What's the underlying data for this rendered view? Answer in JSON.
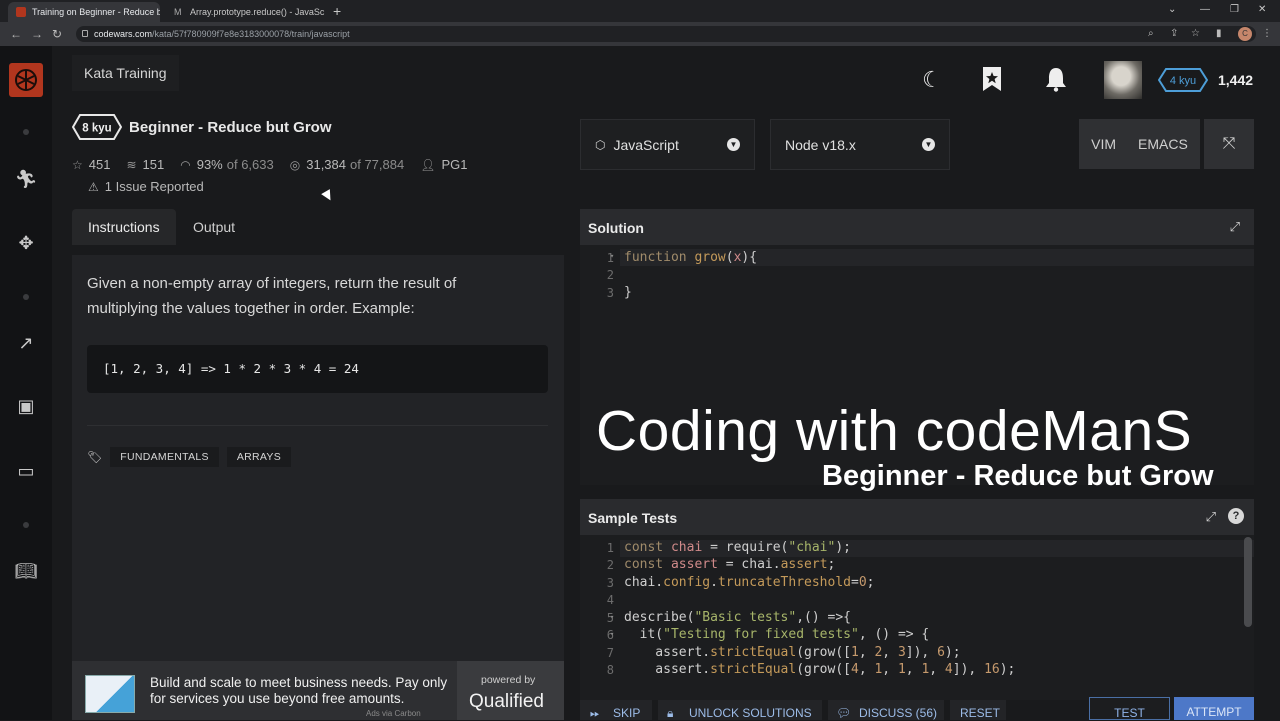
{
  "browser": {
    "tabs": [
      {
        "title": "Training on Beginner - Reduce bu",
        "active": true
      },
      {
        "title": "Array.prototype.reduce() - JavaSc",
        "active": false
      }
    ],
    "url_host": "codewars.com",
    "url_path": "/kata/57f780909f7e8e3183000078/train/javascript",
    "profile_initial": "C"
  },
  "header": {
    "section": "Kata Training",
    "user_rank": "4 kyu",
    "honor": "1,442"
  },
  "kata": {
    "rank": "8 kyu",
    "title": "Beginner - Reduce but Grow",
    "stars": "451",
    "collections": "151",
    "satisfaction_pct": "93%",
    "satisfaction_of": "of 6,633",
    "completed": "31,384",
    "completed_of": "of 77,884",
    "author": "PG1",
    "issues": "1 Issue Reported"
  },
  "tabs": {
    "instructions": "Instructions",
    "output": "Output"
  },
  "description": {
    "text": "Given a non-empty array of integers, return the result of multiplying the values together in order. Example:",
    "example": "[1, 2, 3, 4] => 1 * 2 * 3 * 4 = 24",
    "tags": [
      "FUNDAMENTALS",
      "ARRAYS"
    ]
  },
  "ad": {
    "text": "Build and scale to meet business needs. Pay only for services you use beyond free amounts.",
    "powered_by": "powered by",
    "brand": "Qualified",
    "via": "Ads via Carbon"
  },
  "editor_settings": {
    "language": "JavaScript",
    "runtime": "Node v18.x",
    "vim": "VIM",
    "emacs": "EMACS"
  },
  "solution": {
    "heading": "Solution",
    "line_numbers": [
      "1",
      "2",
      "3"
    ]
  },
  "overlay": {
    "title": "Coding with codeManS",
    "subtitle": "Beginner - Reduce but Grow"
  },
  "sample_tests": {
    "heading": "Sample Tests",
    "line_numbers": [
      "1",
      "2",
      "3",
      "4",
      "5",
      "6",
      "7",
      "8"
    ]
  },
  "actions": {
    "skip": "SKIP",
    "unlock": "UNLOCK SOLUTIONS",
    "discuss": "DISCUSS (56)",
    "reset": "RESET",
    "test": "TEST",
    "attempt": "ATTEMPT"
  },
  "colors": {
    "brand_red": "#b1361e",
    "rank_blue": "#4d9ed8",
    "attempt_blue": "#4d78c8"
  }
}
